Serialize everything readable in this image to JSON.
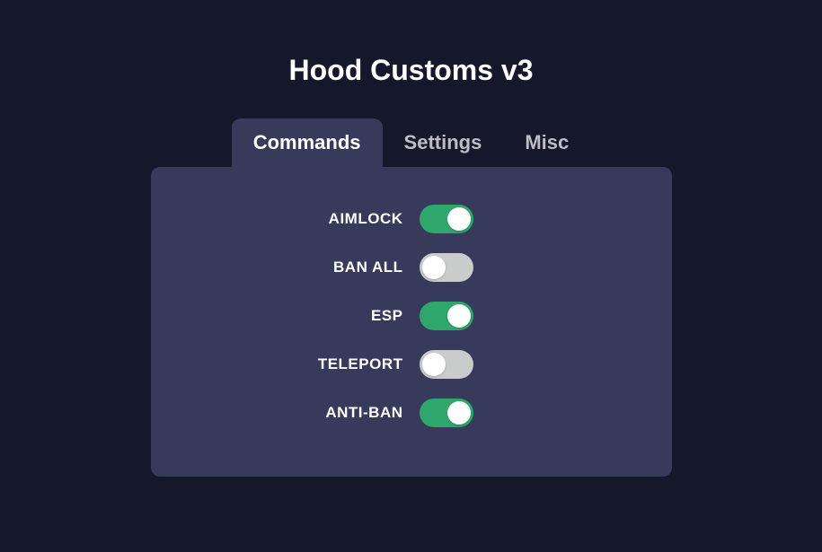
{
  "title": "Hood Customs v3",
  "tabs": [
    {
      "label": "Commands",
      "active": true
    },
    {
      "label": "Settings",
      "active": false
    },
    {
      "label": "Misc",
      "active": false
    }
  ],
  "commands": [
    {
      "label": "AIMLOCK",
      "enabled": true
    },
    {
      "label": "BAN ALL",
      "enabled": false
    },
    {
      "label": "ESP",
      "enabled": true
    },
    {
      "label": "TELEPORT",
      "enabled": false
    },
    {
      "label": "ANTI-BAN",
      "enabled": true
    }
  ],
  "colors": {
    "background": "#15172b",
    "panel": "#373a5a",
    "toggle_on": "#2fa76c",
    "toggle_off": "#cacccc",
    "text_primary": "#ffffff",
    "text_secondary": "#bdbdc7"
  }
}
